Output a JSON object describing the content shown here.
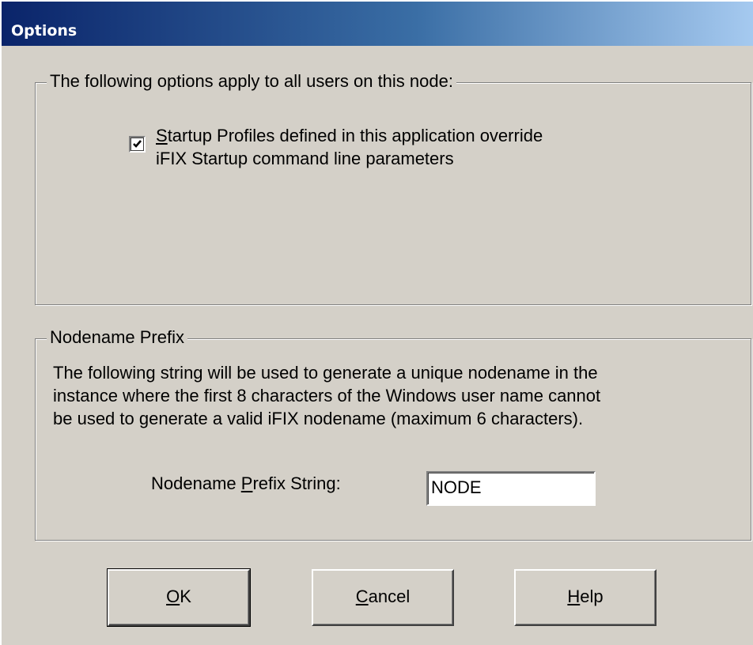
{
  "window": {
    "title": "Options"
  },
  "all_users_group": {
    "legend": "The following options apply to all users on this node:",
    "checkbox": {
      "checked": true,
      "label_mnemonic": "S",
      "label_line1_rest": "tartup Profiles defined in this application override",
      "label_line2": "iFIX Startup command line parameters"
    }
  },
  "nodename_group": {
    "legend": "Nodename Prefix",
    "description_line1": "The following string will be used to generate a unique nodename in the",
    "description_line2": "instance where the first 8 characters of the Windows user name cannot",
    "description_line3": "be used to generate a valid iFIX nodename (maximum 6 characters).",
    "prefix_label_before": "Nodename ",
    "prefix_label_mnemonic": "P",
    "prefix_label_after": "refix String:",
    "prefix_value": "NODE"
  },
  "buttons": {
    "ok_mnemonic": "O",
    "ok_rest": "K",
    "cancel_mnemonic": "C",
    "cancel_rest": "ancel",
    "help_mnemonic": "H",
    "help_rest": "elp"
  }
}
